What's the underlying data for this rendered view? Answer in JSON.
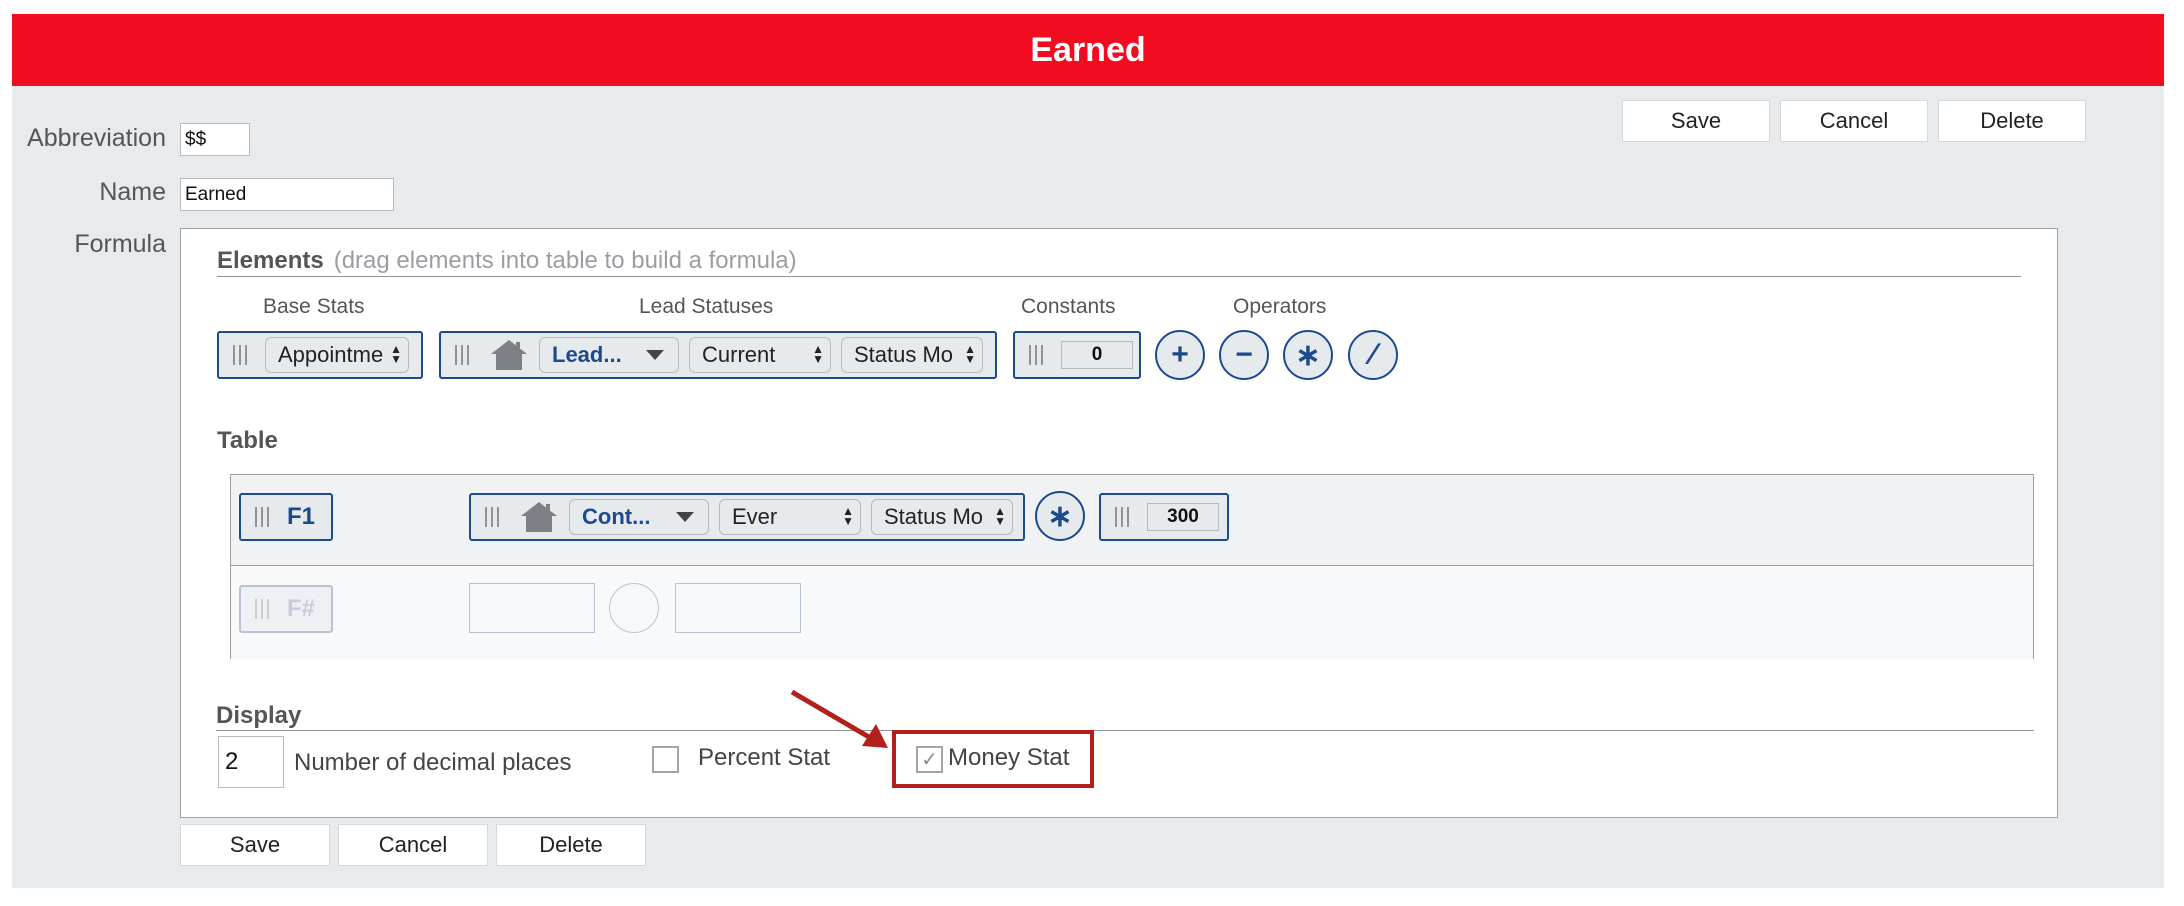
{
  "title": "Earned",
  "top_actions": {
    "save": "Save",
    "cancel": "Cancel",
    "delete": "Delete"
  },
  "bottom_actions": {
    "save": "Save",
    "cancel": "Cancel",
    "delete": "Delete"
  },
  "fields": {
    "abbreviation": {
      "label": "Abbreviation",
      "value": "$$"
    },
    "name": {
      "label": "Name",
      "value": "Earned"
    },
    "formula_label": "Formula"
  },
  "elements": {
    "title": "Elements",
    "hint": "(drag elements into table to build a formula)",
    "base_stats": {
      "label": "Base Stats",
      "select": "Appointme"
    },
    "lead_statuses": {
      "label": "Lead Statuses",
      "lead": "Lead...",
      "time": "Current",
      "mode": "Status Mo"
    },
    "constants": {
      "label": "Constants",
      "value": "0"
    },
    "operators": {
      "label": "Operators",
      "items": [
        "+",
        "−",
        "∗",
        "∕"
      ]
    }
  },
  "table": {
    "title": "Table",
    "row1": {
      "id": "F1",
      "lead": "Cont...",
      "time": "Ever",
      "mode": "Status Mo",
      "operator": "∗",
      "constant": "300"
    },
    "row2": {
      "id": "F#"
    }
  },
  "display": {
    "title": "Display",
    "decimal_places": {
      "value": "2",
      "label": "Number of decimal places"
    },
    "percent_stat": {
      "label": "Percent Stat",
      "checked": false
    },
    "money_stat": {
      "label": "Money Stat",
      "checked": true,
      "check_glyph": "✓"
    }
  },
  "colors": {
    "title_bar": "#f20c1f",
    "accent_blue": "#1c4a8f",
    "annotation": "#b3201c"
  }
}
